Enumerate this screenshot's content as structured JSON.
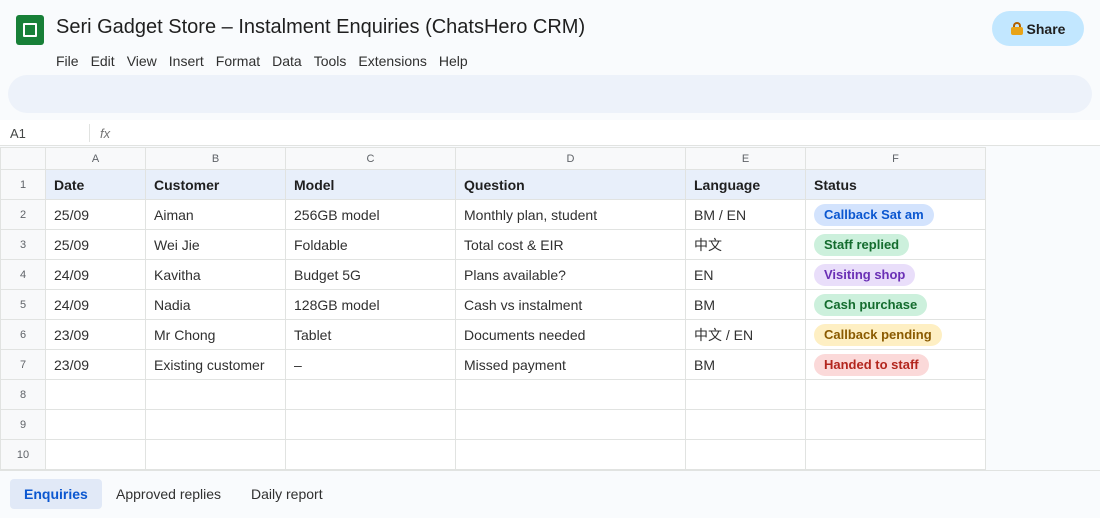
{
  "header": {
    "title": "Seri Gadget Store – Instalment Enquiries (ChatsHero CRM)",
    "logo_icon": "sheets-logo-icon",
    "share_label": "Share",
    "share_icon": "lock-icon"
  },
  "menu": [
    "File",
    "Edit",
    "View",
    "Insert",
    "Format",
    "Data",
    "Tools",
    "Extensions",
    "Help"
  ],
  "formula_bar": {
    "cell_ref": "A1",
    "fx_label": "fx"
  },
  "grid": {
    "column_letters": [
      "A",
      "B",
      "C",
      "D",
      "E",
      "F"
    ],
    "row_numbers": [
      "1",
      "2",
      "3",
      "4",
      "5",
      "6",
      "7",
      "8",
      "9",
      "10"
    ],
    "headers": [
      "Date",
      "Customer",
      "Model",
      "Question",
      "Language",
      "Status"
    ],
    "rows": [
      [
        "25/09",
        "Aiman",
        "256GB model",
        "Monthly plan, student",
        "BM / EN",
        "Callback Sat am"
      ],
      [
        "25/09",
        "Wei Jie",
        "Foldable",
        "Total cost & EIR",
        "中文",
        "Staff replied"
      ],
      [
        "24/09",
        "Kavitha",
        "Budget 5G",
        "Plans available?",
        "EN",
        "Visiting shop"
      ],
      [
        "24/09",
        "Nadia",
        "128GB model",
        "Cash vs instalment",
        "BM",
        "Cash purchase"
      ],
      [
        "23/09",
        "Mr Chong",
        "Tablet",
        "Documents needed",
        "中文 / EN",
        "Callback pending"
      ],
      [
        "23/09",
        "Existing customer",
        "–",
        "Missed payment",
        "BM",
        "Handed to staff"
      ]
    ],
    "status_colors": [
      {
        "bg": "#d3e3fd",
        "fg": "#0b57d0"
      },
      {
        "bg": "#ccf0dc",
        "fg": "#146c2e"
      },
      {
        "bg": "#e9defa",
        "fg": "#6a2fb5"
      },
      {
        "bg": "#ccf0dc",
        "fg": "#146c2e"
      },
      {
        "bg": "#feefc3",
        "fg": "#8a5a00"
      },
      {
        "bg": "#fbd9d9",
        "fg": "#b3261e"
      }
    ]
  },
  "sheets": {
    "tabs": [
      "Enquiries",
      "Approved replies",
      "Daily report"
    ],
    "active": "Enquiries"
  }
}
